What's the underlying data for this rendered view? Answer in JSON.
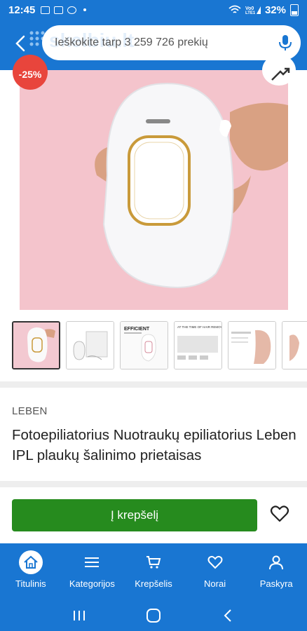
{
  "status": {
    "time": "12:45",
    "battery": "32%"
  },
  "header": {
    "search_placeholder": "Ieškokite tarp 3 259 726 prekių",
    "brand_watermark": "skelbiu.lt"
  },
  "product": {
    "discount": "-25%",
    "brand": "LEBEN",
    "title": "Fotoepiliatorius Nuotraukų epiliatorius Leben IPL plaukų šalinimo prietaisas",
    "cart_label": "Į krepšelį"
  },
  "nav": {
    "items": [
      {
        "label": "Titulinis",
        "icon": "home-icon"
      },
      {
        "label": "Kategorijos",
        "icon": "menu-icon"
      },
      {
        "label": "Krepšelis",
        "icon": "cart-icon"
      },
      {
        "label": "Norai",
        "icon": "heart-icon"
      },
      {
        "label": "Paskyra",
        "icon": "user-icon"
      }
    ]
  },
  "colors": {
    "primary": "#1976d2",
    "cart_green": "#268b1e",
    "badge_red": "#e8453c"
  }
}
